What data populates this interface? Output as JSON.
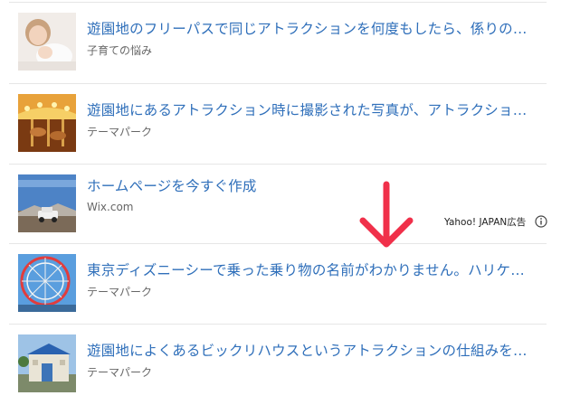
{
  "items": [
    {
      "title": "遊園地のフリーパスで同じアトラクションを何度もしたら、係りの…",
      "source": "子育ての悩み",
      "thumb_icon": "baby-photo"
    },
    {
      "title": "遊園地にあるアトラクション時に撮影された写真が、アトラクショ…",
      "source": "テーマパーク",
      "thumb_icon": "carousel-photo"
    },
    {
      "title": "ホームページを今すぐ作成",
      "source": "Wix.com",
      "thumb_icon": "car-landscape-photo"
    },
    {
      "title": "東京ディズニーシーで乗った乗り物の名前がわかりません。ハリケ…",
      "source": "テーマパーク",
      "thumb_icon": "ferris-wheel-photo"
    },
    {
      "title": "遊園地によくあるビックリハウスというアトラクションの仕組みを…",
      "source": "テーマパーク",
      "thumb_icon": "funhouse-photo"
    }
  ],
  "ad": {
    "label": "Yahoo! JAPAN広告",
    "icon": "info-icon"
  },
  "annotation": {
    "icon": "red-down-arrow-icon",
    "color": "#f0304a"
  },
  "colors": {
    "title": "#2f6fba",
    "source": "#666666",
    "divider": "#e6e6e6"
  }
}
